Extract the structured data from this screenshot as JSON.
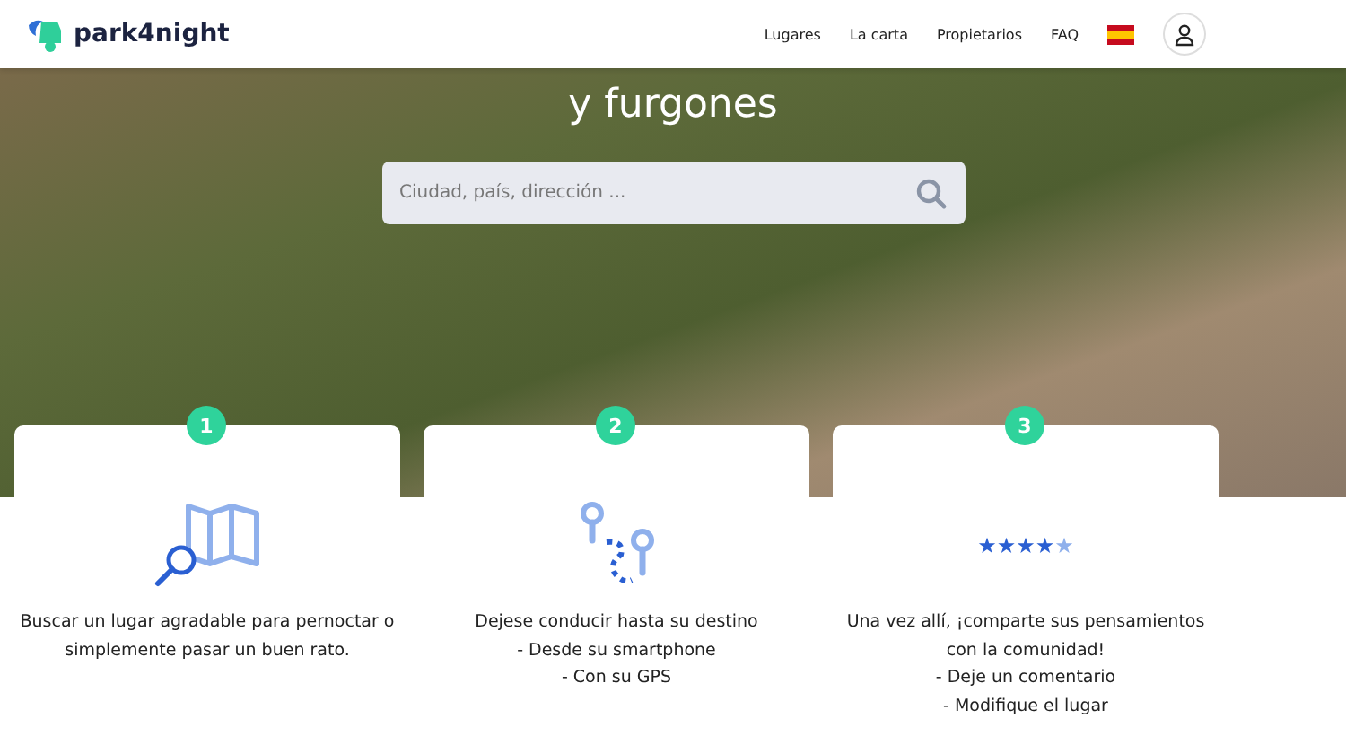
{
  "header": {
    "logo": "park4night",
    "nav": [
      {
        "label": "Lugares"
      },
      {
        "label": "La carta"
      },
      {
        "label": "Propietarios"
      },
      {
        "label": "FAQ"
      }
    ]
  },
  "hero": {
    "heading": "y furgones",
    "search": {
      "placeholder": "Ciudad, país, dirección ..."
    }
  },
  "steps": [
    {
      "number": "1",
      "kind": "map",
      "lines": [
        "Buscar un lugar agradable para pernoctar o",
        "simplemente pasar un buen rato."
      ]
    },
    {
      "number": "2",
      "kind": "route",
      "lines": [
        "Dejese conducir hasta su destino",
        "- Desde su smartphone",
        "- Con su GPS"
      ]
    },
    {
      "number": "3",
      "kind": "rating",
      "stars": 4,
      "lines": [
        "Una vez allí, ¡comparte sus pensamientos",
        "con la comunidad!",
        "- Deje un comentario",
        "- Modifique el lugar"
      ]
    }
  ]
}
